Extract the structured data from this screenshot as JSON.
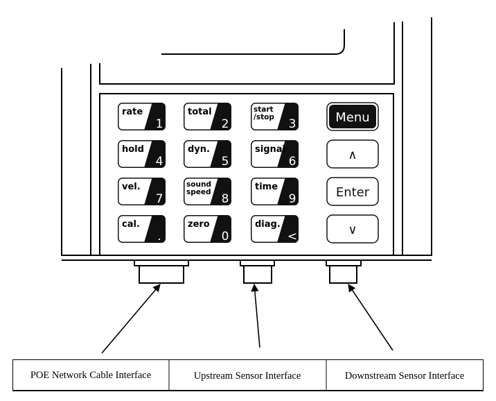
{
  "keypad": {
    "number_keys": [
      {
        "label": [
          "rate"
        ],
        "digit": "1"
      },
      {
        "label": [
          "total"
        ],
        "digit": "2"
      },
      {
        "label": [
          "start",
          "/stop"
        ],
        "digit": "3"
      },
      {
        "label": [
          "hold"
        ],
        "digit": "4"
      },
      {
        "label": [
          "dyn."
        ],
        "digit": "5"
      },
      {
        "label": [
          "signal"
        ],
        "digit": "6"
      },
      {
        "label": [
          "vel."
        ],
        "digit": "7"
      },
      {
        "label": [
          "sound",
          "speed"
        ],
        "digit": "8"
      },
      {
        "label": [
          "time"
        ],
        "digit": "9"
      },
      {
        "label": [
          "cal."
        ],
        "digit": "."
      },
      {
        "label": [
          "zero"
        ],
        "digit": "0"
      },
      {
        "label": [
          "diag."
        ],
        "digit": "<"
      }
    ],
    "nav_keys": [
      {
        "label": "Menu",
        "style": "inverted"
      },
      {
        "label": "∧",
        "icon": "up-arrow"
      },
      {
        "label": "Enter"
      },
      {
        "label": "∨",
        "icon": "down-arrow"
      }
    ]
  },
  "interfaces": [
    {
      "label": "POE Network Cable Interface"
    },
    {
      "label": "Upstream Sensor Interface"
    },
    {
      "label": "Downstream Sensor Interface"
    }
  ]
}
